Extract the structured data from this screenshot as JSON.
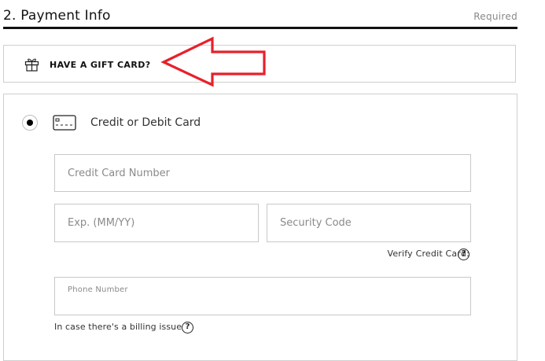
{
  "section": {
    "title": "2. Payment Info",
    "required_label": "Required"
  },
  "gift_card": {
    "label": "HAVE A GIFT CARD?",
    "icon": "gift-icon"
  },
  "annotation": {
    "color": "#e8202a",
    "icon": "red-arrow-pointer"
  },
  "payment_method": {
    "selected": true,
    "icon": "credit-card-icon",
    "label": "Credit or Debit Card"
  },
  "fields": {
    "card_number": {
      "placeholder": "Credit Card Number",
      "value": ""
    },
    "expiration": {
      "placeholder": "Exp. (MM/YY)",
      "value": ""
    },
    "security_code": {
      "placeholder": "Security Code",
      "value": ""
    },
    "phone": {
      "label": "Phone Number",
      "value": ""
    }
  },
  "verify_card": {
    "label": "Verify Credit Card:",
    "help_glyph": "?"
  },
  "billing_note": {
    "label": "In case there's a billing issue",
    "help_glyph": "?"
  }
}
